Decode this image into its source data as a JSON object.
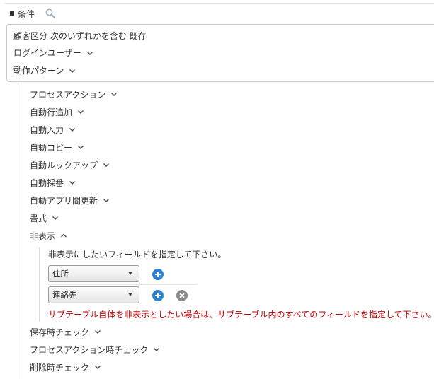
{
  "header": {
    "title": "条件"
  },
  "condition_box": {
    "line1": "顧客区分 次のいずれかを含む 既存",
    "line2": "ログインユーザー",
    "line3": "動作パターン"
  },
  "items": [
    {
      "label": "プロセスアクション"
    },
    {
      "label": "自動行追加"
    },
    {
      "label": "自動入力"
    },
    {
      "label": "自動コピー"
    },
    {
      "label": "自動ルックアップ"
    },
    {
      "label": "自動採番"
    },
    {
      "label": "自動アプリ間更新"
    },
    {
      "label": "書式"
    },
    {
      "label": "非表示"
    }
  ],
  "hidden_section": {
    "instruction": "非表示にしたいフィールドを指定して下さい。",
    "fields": [
      {
        "value": "住所"
      },
      {
        "value": "連絡先"
      }
    ],
    "warning": "サブテーブル自体を非表示としたい場合は、サブテーブル内のすべてのフィールドを指定して下さい。"
  },
  "items_after": [
    {
      "label": "保存時チェック"
    },
    {
      "label": "プロセスアクション時チェック"
    },
    {
      "label": "削除時チェック"
    }
  ],
  "colors": {
    "add_button": "#2a82d6",
    "remove_button": "#8a8a8a",
    "warning_text": "#c00000"
  },
  "icons": {
    "search": "search-icon",
    "chevron_down": "chevron-down-icon",
    "chevron_up": "chevron-up-icon",
    "add": "plus-circle-icon",
    "remove": "x-circle-icon"
  }
}
